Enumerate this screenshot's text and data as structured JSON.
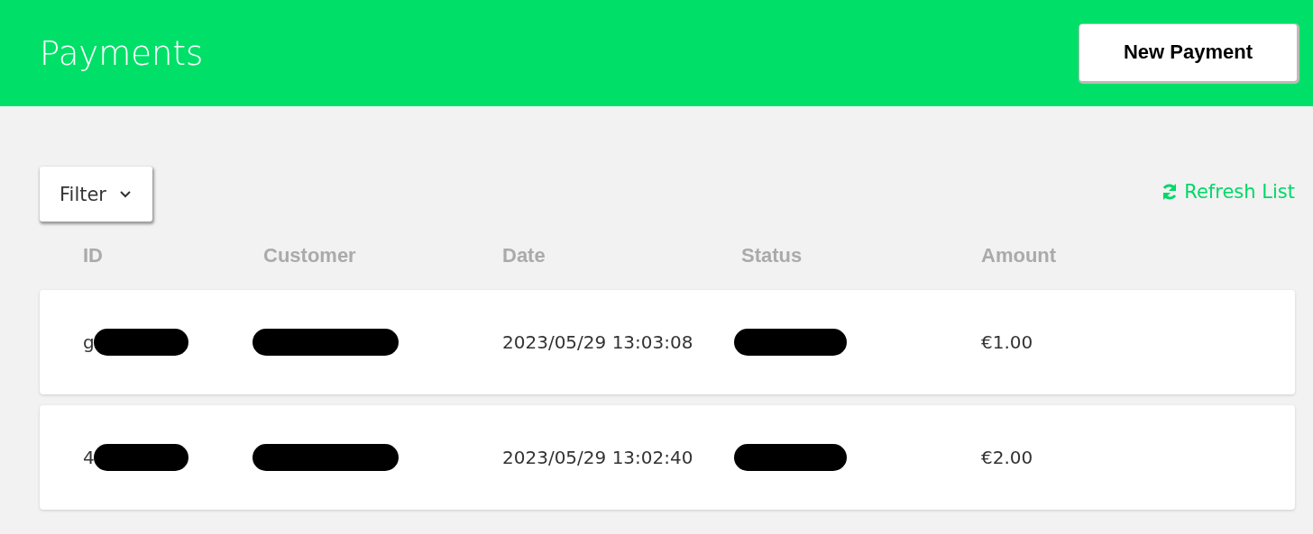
{
  "header": {
    "title": "Payments",
    "button": "New Payment"
  },
  "toolbar": {
    "filter": "Filter",
    "refresh": "Refresh List"
  },
  "table": {
    "columns": [
      "ID",
      "Customer",
      "Date",
      "Status",
      "Amount"
    ],
    "rows": [
      {
        "id": "g",
        "id_redacted": true,
        "customer_redacted": true,
        "date": "2023/05/29 13:03:08",
        "status_redacted": true,
        "amount": "€1.00"
      },
      {
        "id": "4",
        "id_redacted": true,
        "customer_redacted": true,
        "date": "2023/05/29 13:02:40",
        "status_redacted": true,
        "amount": "€2.00"
      }
    ]
  }
}
